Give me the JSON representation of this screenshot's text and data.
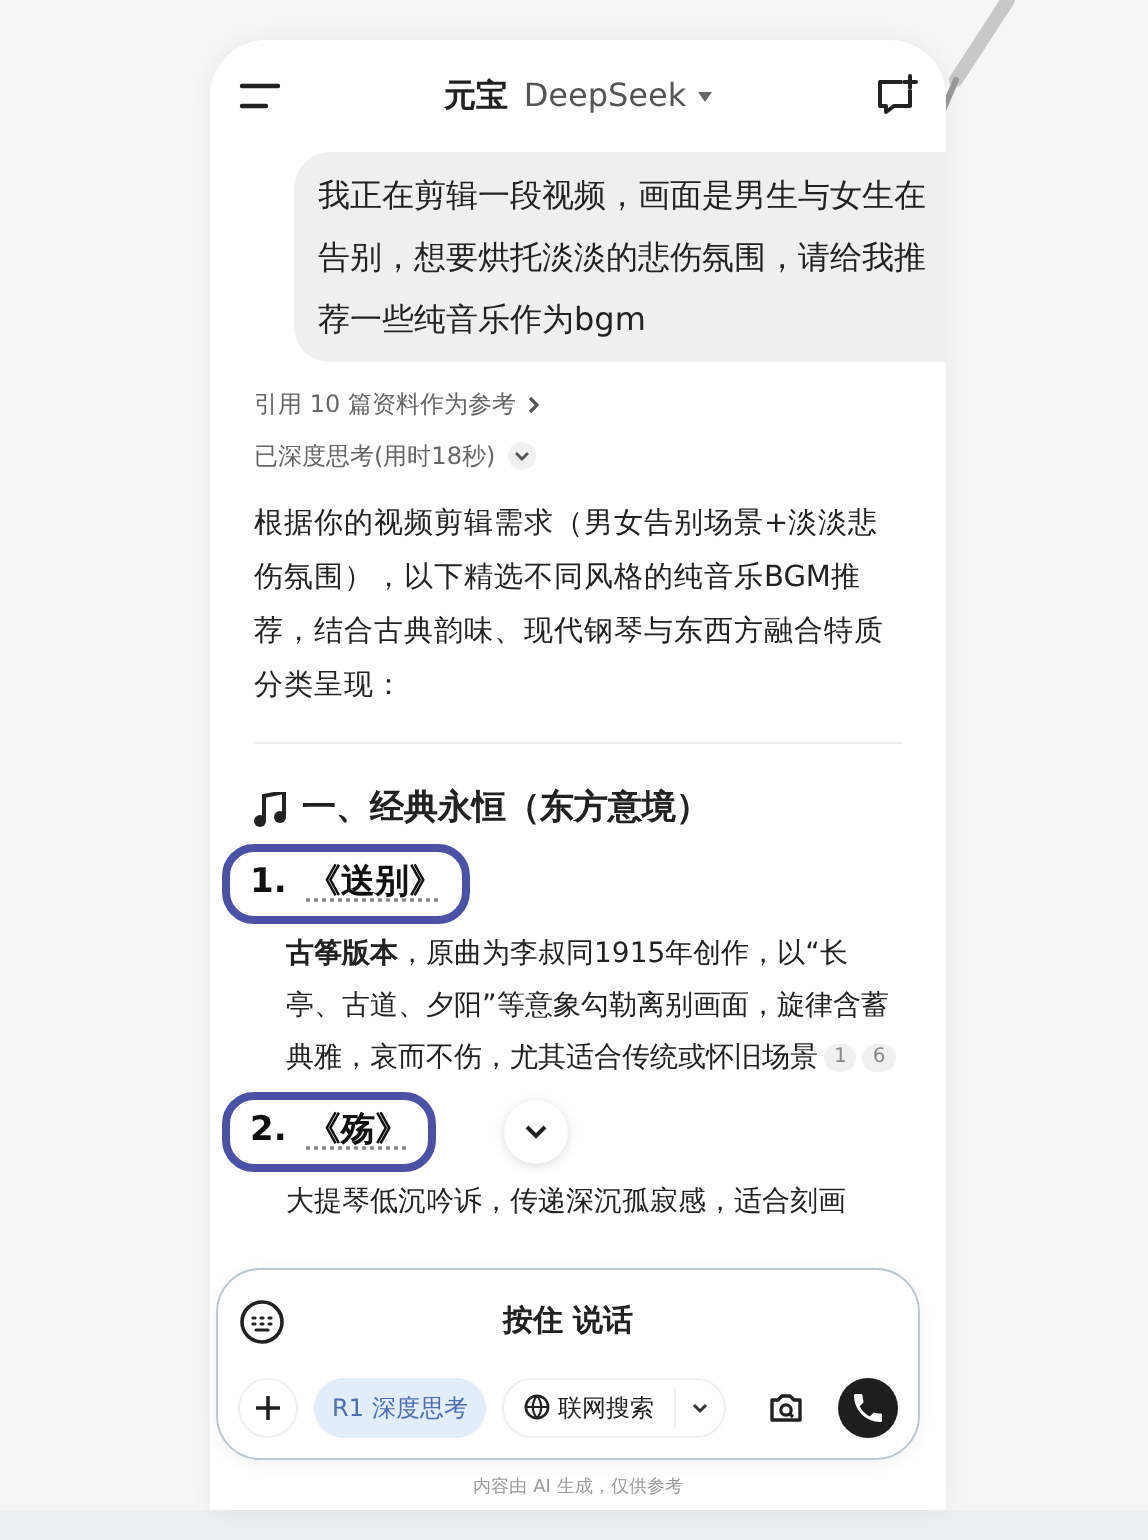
{
  "header": {
    "title": "元宝",
    "model": "DeepSeek"
  },
  "user_message": "我正在剪辑一段视频，画面是男生与女生在告别，想要烘托淡淡的悲伤氛围，请给我推荐一些纯音乐作为bgm",
  "references": "引用 10 篇资料作为参考",
  "thinking": {
    "label": "已深度思考(用时18秒)",
    "expanded": false
  },
  "intro": "根据你的视频剪辑需求（男女告别场景+淡淡悲伤氛围），以下精选不同风格的纯音乐BGM推荐，结合古典韵味、现代钢琴与东西方融合特质分类呈现：",
  "section_heading": "一、经典永恒（东方意境）",
  "items": [
    {
      "number": "1.",
      "title": "《送别》",
      "highlighted": true,
      "description": "**古筝版本**，原曲为李叔同1915年创作，以“长亭、古道、夕阳”等意象勾勒离别画面，旋律含蓄典雅，哀而不伤，尤其适合传统或怀旧场景",
      "citations": [
        "1",
        "6"
      ]
    },
    {
      "number": "2.",
      "title": "《殇》",
      "highlighted": true,
      "description": "大提琴低沉吟诉，传递深沉孤寂感，适合刻画"
    }
  ],
  "composer": {
    "hold_to_talk": "按住 说话",
    "tools": [
      {
        "kind": "plus"
      },
      {
        "kind": "toggle",
        "prefix": "R1",
        "label": "深度思考",
        "selected": true
      },
      {
        "kind": "dropdown",
        "label": "联网搜索",
        "selected": false
      }
    ]
  },
  "disclaimer": "内容由 AI 生成，仅供参考"
}
